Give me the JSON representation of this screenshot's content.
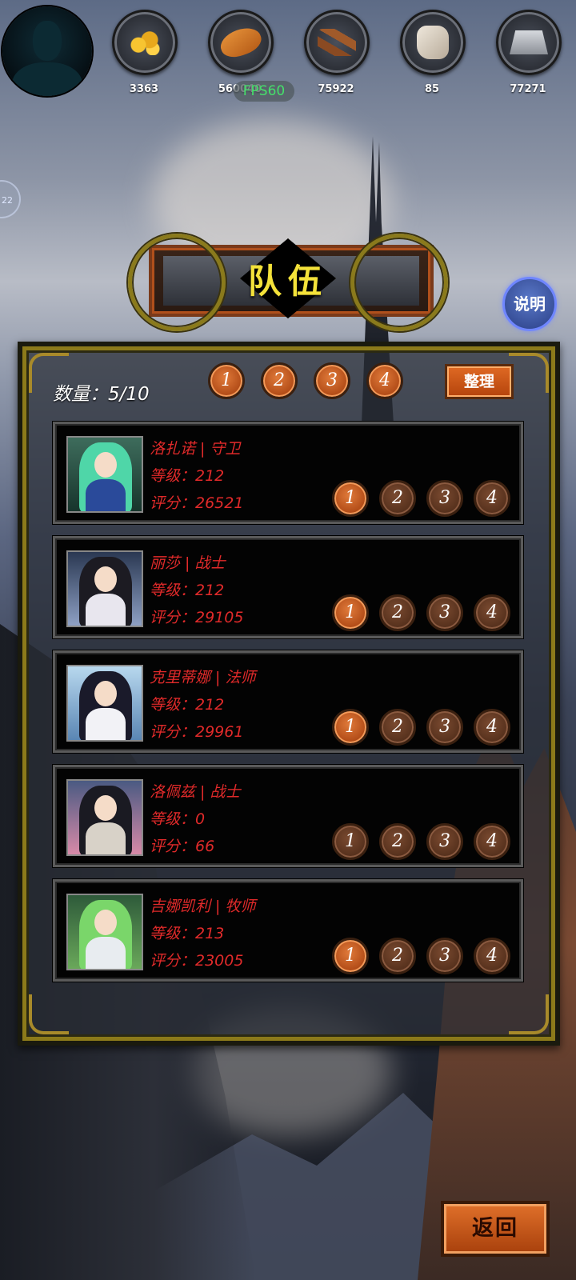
{
  "resources": [
    {
      "icon": "gold-coins-icon",
      "value": "3363"
    },
    {
      "icon": "bread-icon",
      "value": "560040"
    },
    {
      "icon": "wood-logs-icon",
      "value": "75922"
    },
    {
      "icon": "stone-icon",
      "value": "85"
    },
    {
      "icon": "iron-ingot-icon",
      "value": "77271"
    }
  ],
  "fps": "FPS60",
  "side_peek": "22",
  "title": "队伍",
  "help_label": "说明",
  "team": {
    "count_label": "数量：5/10",
    "filters": [
      "1",
      "2",
      "3",
      "4"
    ],
    "sort_label": "整理"
  },
  "heroes": [
    {
      "name": "洛扎诺 | 守卫",
      "level": "等级：212",
      "score": "评分：26521",
      "team_buttons": [
        "1",
        "2",
        "3",
        "4"
      ],
      "active_team": "1"
    },
    {
      "name": "丽莎 | 战士",
      "level": "等级：212",
      "score": "评分：29105",
      "team_buttons": [
        "1",
        "2",
        "3",
        "4"
      ],
      "active_team": "1"
    },
    {
      "name": "克里蒂娜 | 法师",
      "level": "等级：212",
      "score": "评分：29961",
      "team_buttons": [
        "1",
        "2",
        "3",
        "4"
      ],
      "active_team": "1"
    },
    {
      "name": "洛佩兹 | 战士",
      "level": "等级：0",
      "score": "评分：66",
      "team_buttons": [
        "1",
        "2",
        "3",
        "4"
      ],
      "active_team": ""
    },
    {
      "name": "吉娜凯利 | 牧师",
      "level": "等级：213",
      "score": "评分：23005",
      "team_buttons": [
        "1",
        "2",
        "3",
        "4"
      ],
      "active_team": "1"
    }
  ],
  "back_label": "返回",
  "colors": {
    "accent_orange": "#c8561a",
    "title_yellow": "#f4e23a",
    "hero_text_red": "#e02a2a",
    "fps_green": "#45e06a"
  }
}
